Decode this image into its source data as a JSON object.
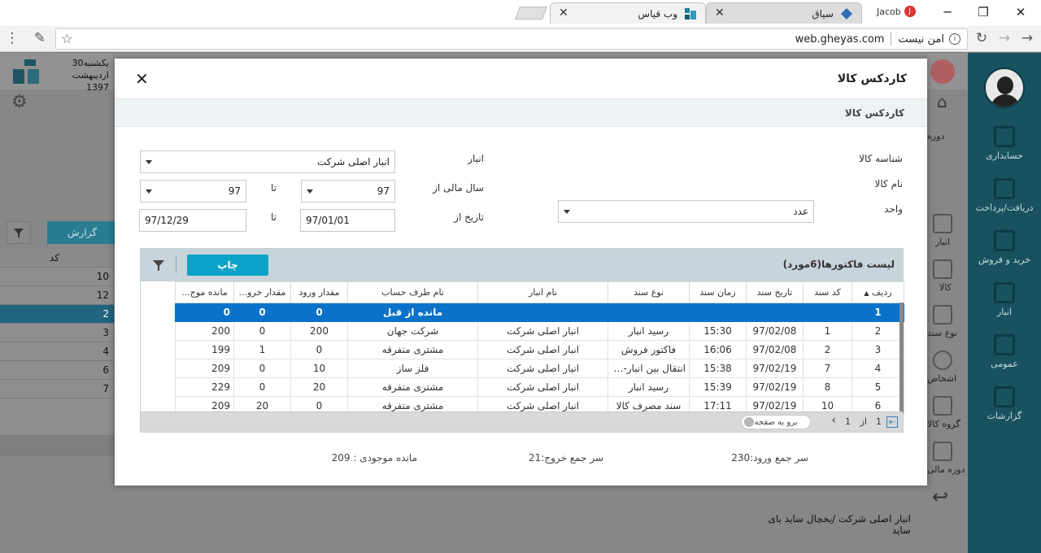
{
  "browser": {
    "tabs": [
      {
        "label": "سیاق",
        "active": false
      },
      {
        "label": "وب قیاس",
        "active": true
      }
    ],
    "profile_name": "Jacob",
    "url": "web.gheyas.com",
    "security_label": "امن نیست"
  },
  "app": {
    "date_line1": "یکشنبه30",
    "date_line2": "اردیبهشت 1397",
    "report_label": "گزارش",
    "left_table_header": "کد",
    "left_table_rows": [
      "10",
      "12",
      "2",
      "3",
      "4",
      "6",
      "7"
    ],
    "bg_labels": {
      "doreh": "دوره",
      "anbar": "انبار",
      "kala": "کالا",
      "noe_sanad": "نوع سند",
      "ashkhas": "اشخاص",
      "goroh_kala": "گروه کالا",
      "doreh_mali": "دوره مالی"
    },
    "bottom_text": "انبار اصلی شرکت /یخچال ساید بای ساید"
  },
  "sidebar": {
    "items": [
      {
        "label": "حسابداری"
      },
      {
        "label": "دریافت/پرداخت"
      },
      {
        "label": "خرید و فروش"
      },
      {
        "label": "انبار"
      },
      {
        "label": "عمومی"
      },
      {
        "label": "گزارشات"
      }
    ]
  },
  "modal": {
    "title": "کاردکس کالا",
    "subtitle": "کاردکس کالا",
    "labels": {
      "shenaseh": "شناسه کالا",
      "name": "نام کالا",
      "vahed": "واحد",
      "anbar": "انبار",
      "sal_mali": "سال مالی از",
      "tarikh": "تاریخ از",
      "ta1": "تا",
      "ta2": "تا"
    },
    "values": {
      "vahed": "عدد",
      "anbar": "انبار اصلی شرکت",
      "sal_from": "97",
      "sal_to": "97",
      "date_from": "97/01/01",
      "date_to": "97/12/29"
    },
    "grid": {
      "title": "لیست فاکتورها(6مورد)",
      "print_label": "چاپ",
      "columns": [
        "ردیف",
        "کد سند",
        "تاریخ سند",
        "زمان سند",
        "نوع سند",
        "نام انبار",
        "نام طرف حساب",
        "مقدار ورود",
        "مقدار خرو...",
        "مانده موج..."
      ],
      "rows": [
        [
          "1",
          "",
          "",
          "",
          "",
          "",
          "مانده از قبل",
          "0",
          "0",
          "0"
        ],
        [
          "2",
          "1",
          "97/02/08",
          "15:30",
          "رسید انبار",
          "انبار اصلی شرکت",
          "شرکت جهان",
          "200",
          "0",
          "200"
        ],
        [
          "3",
          "2",
          "97/02/08",
          "16:06",
          "فاکتور فروش",
          "انبار اصلی شرکت",
          "مشتری متفرقه",
          "0",
          "1",
          "199"
        ],
        [
          "4",
          "7",
          "97/02/19",
          "15:38",
          "انتقال بین انبار-و...",
          "انبار اصلی شرکت",
          "فلز ساز",
          "10",
          "0",
          "209"
        ],
        [
          "5",
          "8",
          "97/02/19",
          "15:39",
          "رسید انبار",
          "انبار اصلی شرکت",
          "مشتری متفرقه",
          "20",
          "0",
          "229"
        ],
        [
          "6",
          "10",
          "97/02/19",
          "17:11",
          "سند مصرف کالا",
          "انبار اصلی شرکت",
          "مشتری متفرقه",
          "0",
          "20",
          "209"
        ]
      ],
      "pager": {
        "page": "1",
        "of_label": "از",
        "total": "1",
        "goto_label": "برو به صفحه"
      }
    },
    "summary": {
      "total_in": "سر جمع ورود:230",
      "total_out": "سر جمع خروج:21",
      "balance": "مانده موجودی : 209"
    }
  }
}
